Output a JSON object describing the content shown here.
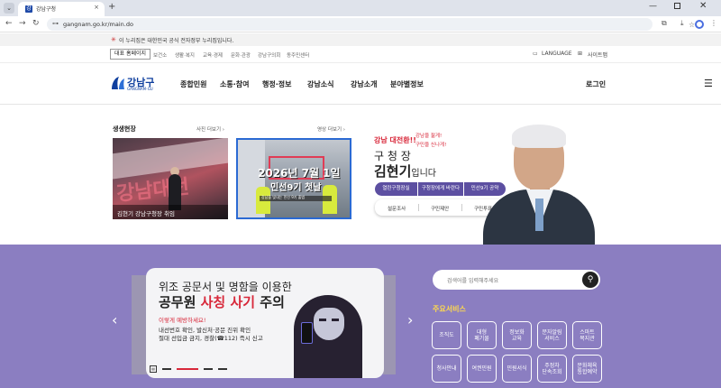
{
  "browser": {
    "tab_title": "강남구청",
    "tab_close": "×",
    "new_tab": "+",
    "url": "gangnam.go.kr/main.do",
    "controls": {
      "minimize": "—",
      "close": "✕"
    }
  },
  "gov_notice": {
    "flag": "✳",
    "text": "이 누리집은 대한민국 공식 전자정부 누리집입니다."
  },
  "utility": {
    "main": "대표 홈페이지",
    "links": [
      "보건소",
      "생활·복지",
      "교육·경제",
      "문화·관광",
      "강남구의회",
      "동주민센터"
    ],
    "language": "LANGUAGE",
    "sitemap": "사이트맵"
  },
  "header": {
    "logo_name": "강남구",
    "logo_sub": "GANGNAM-GU",
    "nav": [
      "종합민원",
      "소통·참여",
      "행정·정보",
      "강남소식",
      "강남소개",
      "분야별정보"
    ],
    "login": "로그인",
    "menu_icon": "☰"
  },
  "vivid": {
    "title": "생생현장",
    "photo_more": "사진 더보기",
    "video_more": "영상 더보기",
    "photo_caption": "김현기 강남구청장 취임",
    "photo_banner": "강남대전",
    "video_title": "2026년 7월 1일",
    "video_subtitle": "민선9기 첫날",
    "video_ribbon": "강남을 빛내는 민선 9기 출범"
  },
  "mayor": {
    "slogan_main": "강남 대전환!!",
    "slogan_a": "강남을 젊게!",
    "slogan_b": "구민을 신나게!",
    "role": "구 청 장",
    "name": "김현기",
    "name_suffix": "입니다",
    "buttons": [
      "열린구청장실",
      "구청장에게 바란다",
      "민선9기 공약"
    ],
    "subs": [
      "설문조사",
      "구민제안",
      "구민투표"
    ]
  },
  "banner": {
    "line1": "위조 공문서 및 명함을 이용한",
    "line2_prefix": "공무원 ",
    "line2_bold": "사칭 사기",
    "line2_suffix": " 주의",
    "warning": "이렇게 예방하세요!",
    "body1": "내선번호 확인, 발신처·공문 진위 확인",
    "body2": "절대 선입금 금지, 경찰(☎112) 즉시 신고",
    "prev": "‹",
    "next": "›"
  },
  "search": {
    "placeholder": "검색어를 입력해주세요",
    "icon": "search-icon"
  },
  "services": {
    "title": "주요서비스",
    "items": [
      "조직도",
      "대형\n폐기물",
      "정보화\n교육",
      "문자알림\n서비스",
      "스마트\n복지관",
      "청사안내",
      "여권민원",
      "민원서식",
      "주정차\n단속조회",
      "문화체육\n통합예약"
    ]
  },
  "colors": {
    "brand": "#0f3f9e",
    "accent": "#d8283a",
    "purple": "#8b7ec1",
    "mayor_button": "#5c4fa1"
  }
}
